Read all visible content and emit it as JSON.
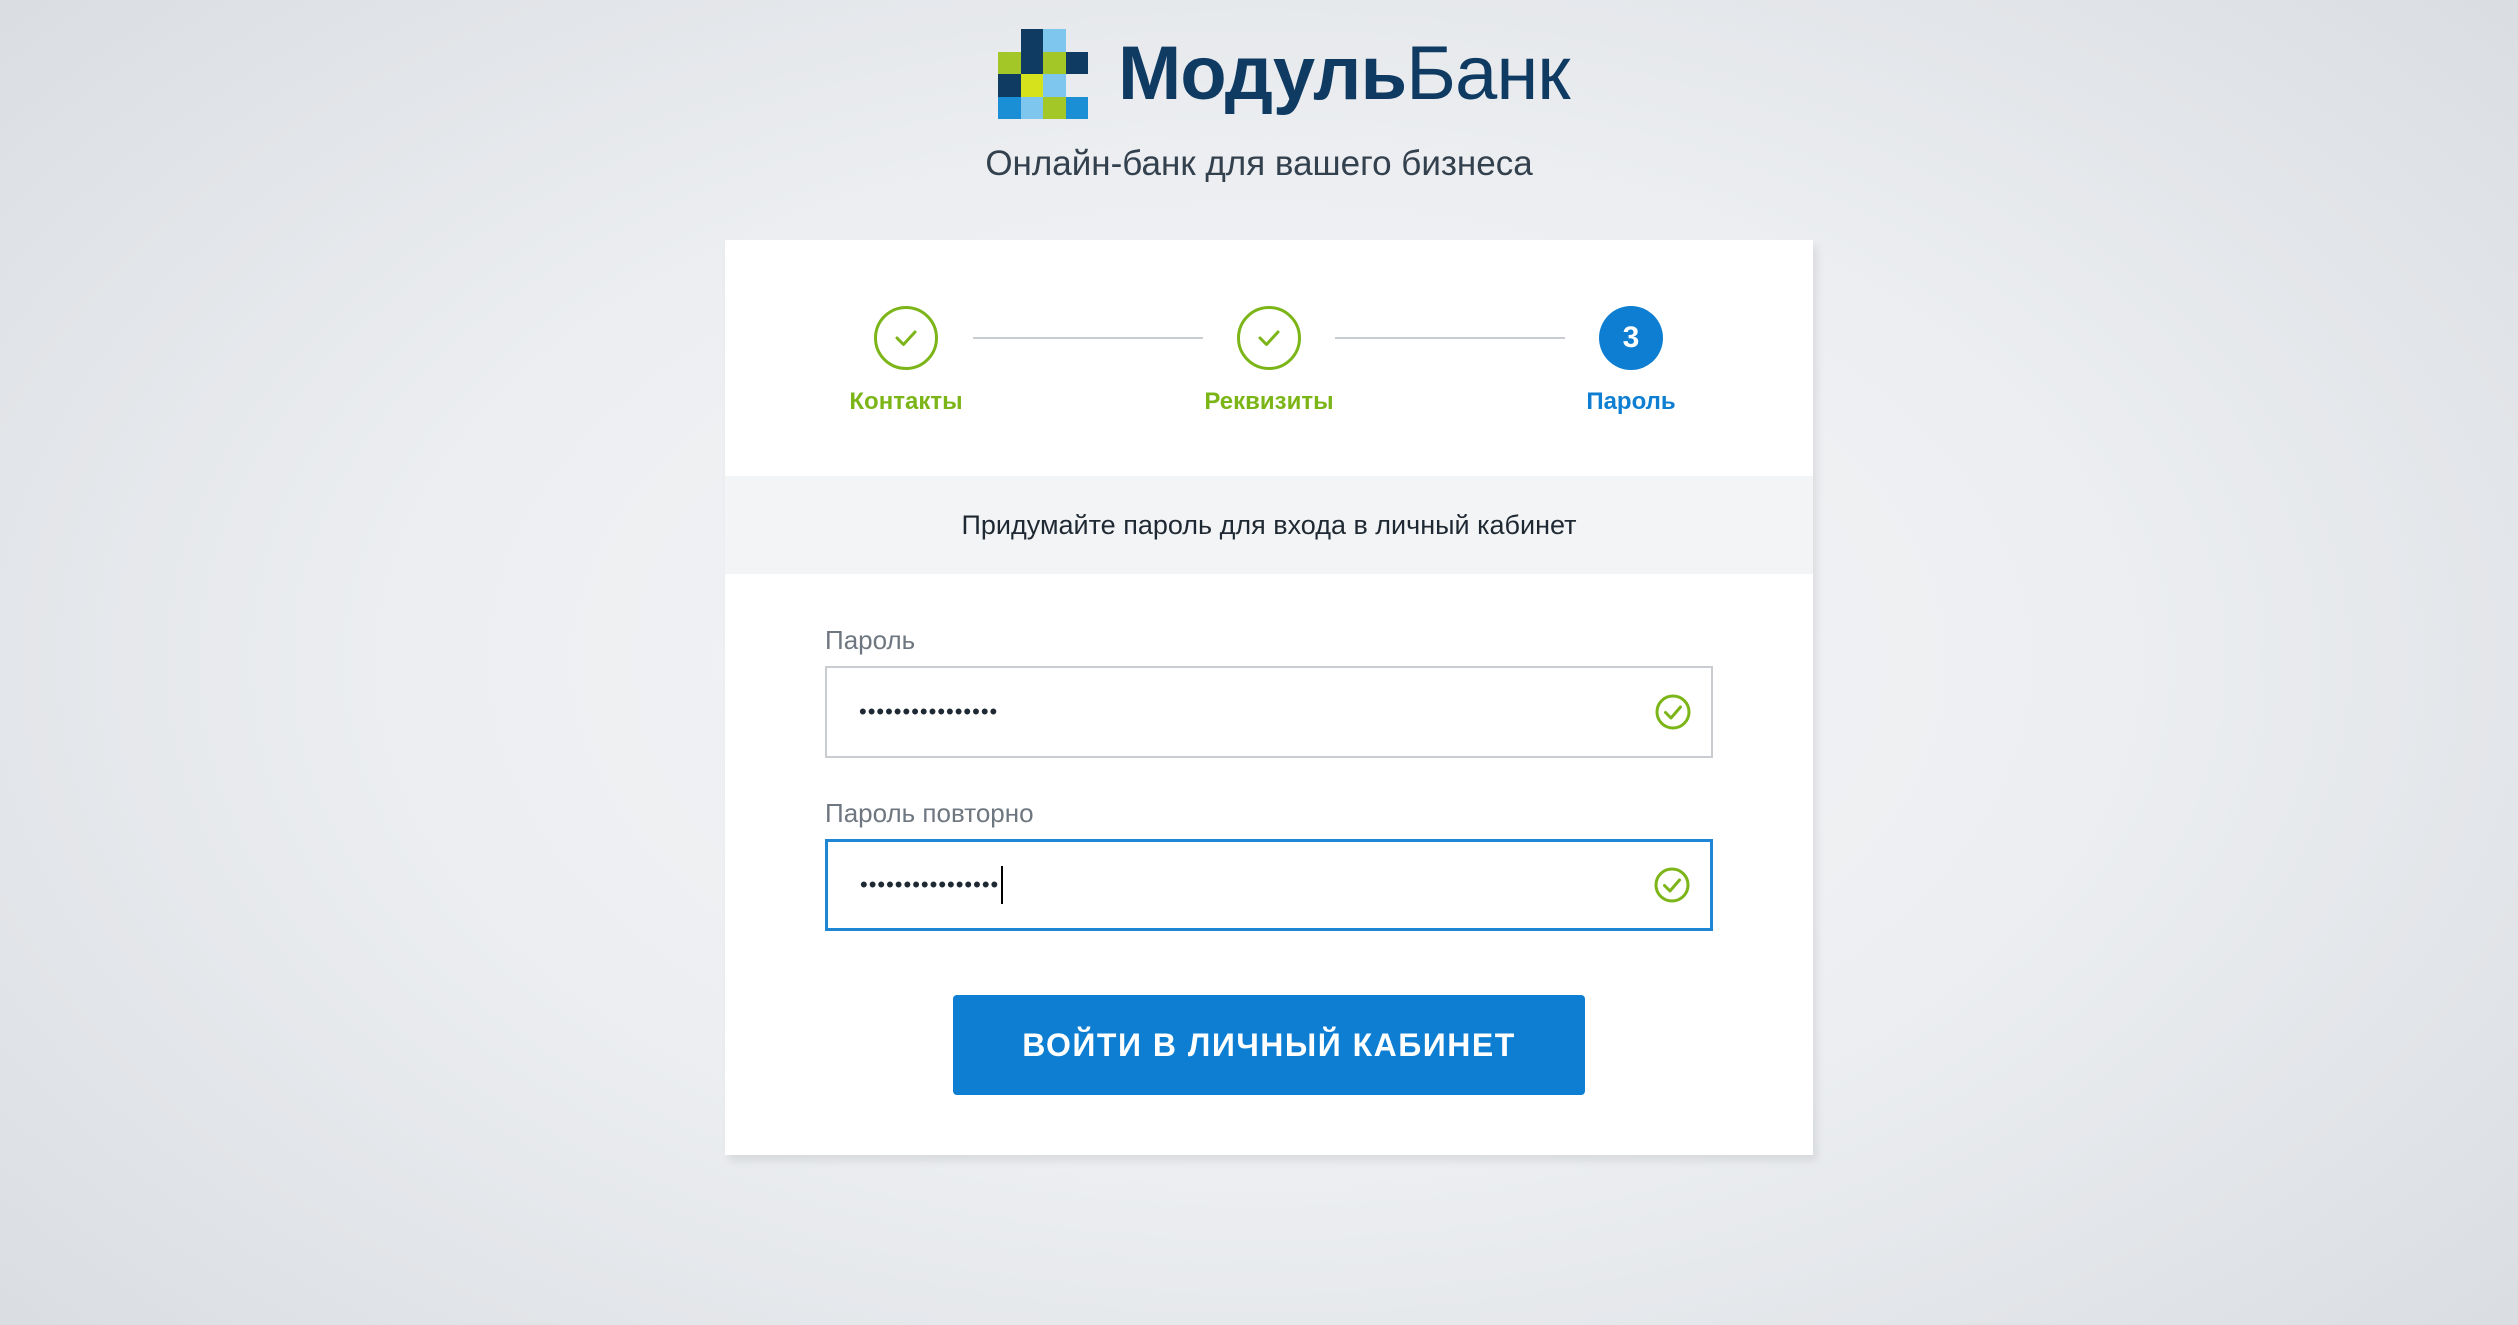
{
  "brand": {
    "name_bold": "Модуль",
    "name_light": "Банк",
    "tagline": "Онлайн-банк для вашего бизнеса",
    "colors": {
      "navy": "#0f3b63",
      "sky": "#7fc6ee",
      "lime": "#a3c726",
      "yellow": "#d6e21b",
      "blue": "#1a8fd6"
    }
  },
  "stepper": {
    "steps": [
      {
        "label": "Контакты",
        "state": "completed",
        "icon": "check-icon"
      },
      {
        "label": "Реквизиты",
        "state": "completed",
        "icon": "check-icon"
      },
      {
        "label": "Пароль",
        "state": "active",
        "number": "3"
      }
    ],
    "colors": {
      "completed": "#7cb518",
      "active": "#0d7ed1"
    }
  },
  "info": {
    "text": "Придумайте пароль для входа в личный кабинет"
  },
  "form": {
    "password": {
      "label": "Пароль",
      "value": "••••••••••••••••",
      "valid": true
    },
    "password_repeat": {
      "label": "Пароль повторно",
      "value": "••••••••••••••••",
      "valid": true,
      "focused": true
    },
    "submit_label": "ВОЙТИ В ЛИЧНЫЙ КАБИНЕТ"
  }
}
